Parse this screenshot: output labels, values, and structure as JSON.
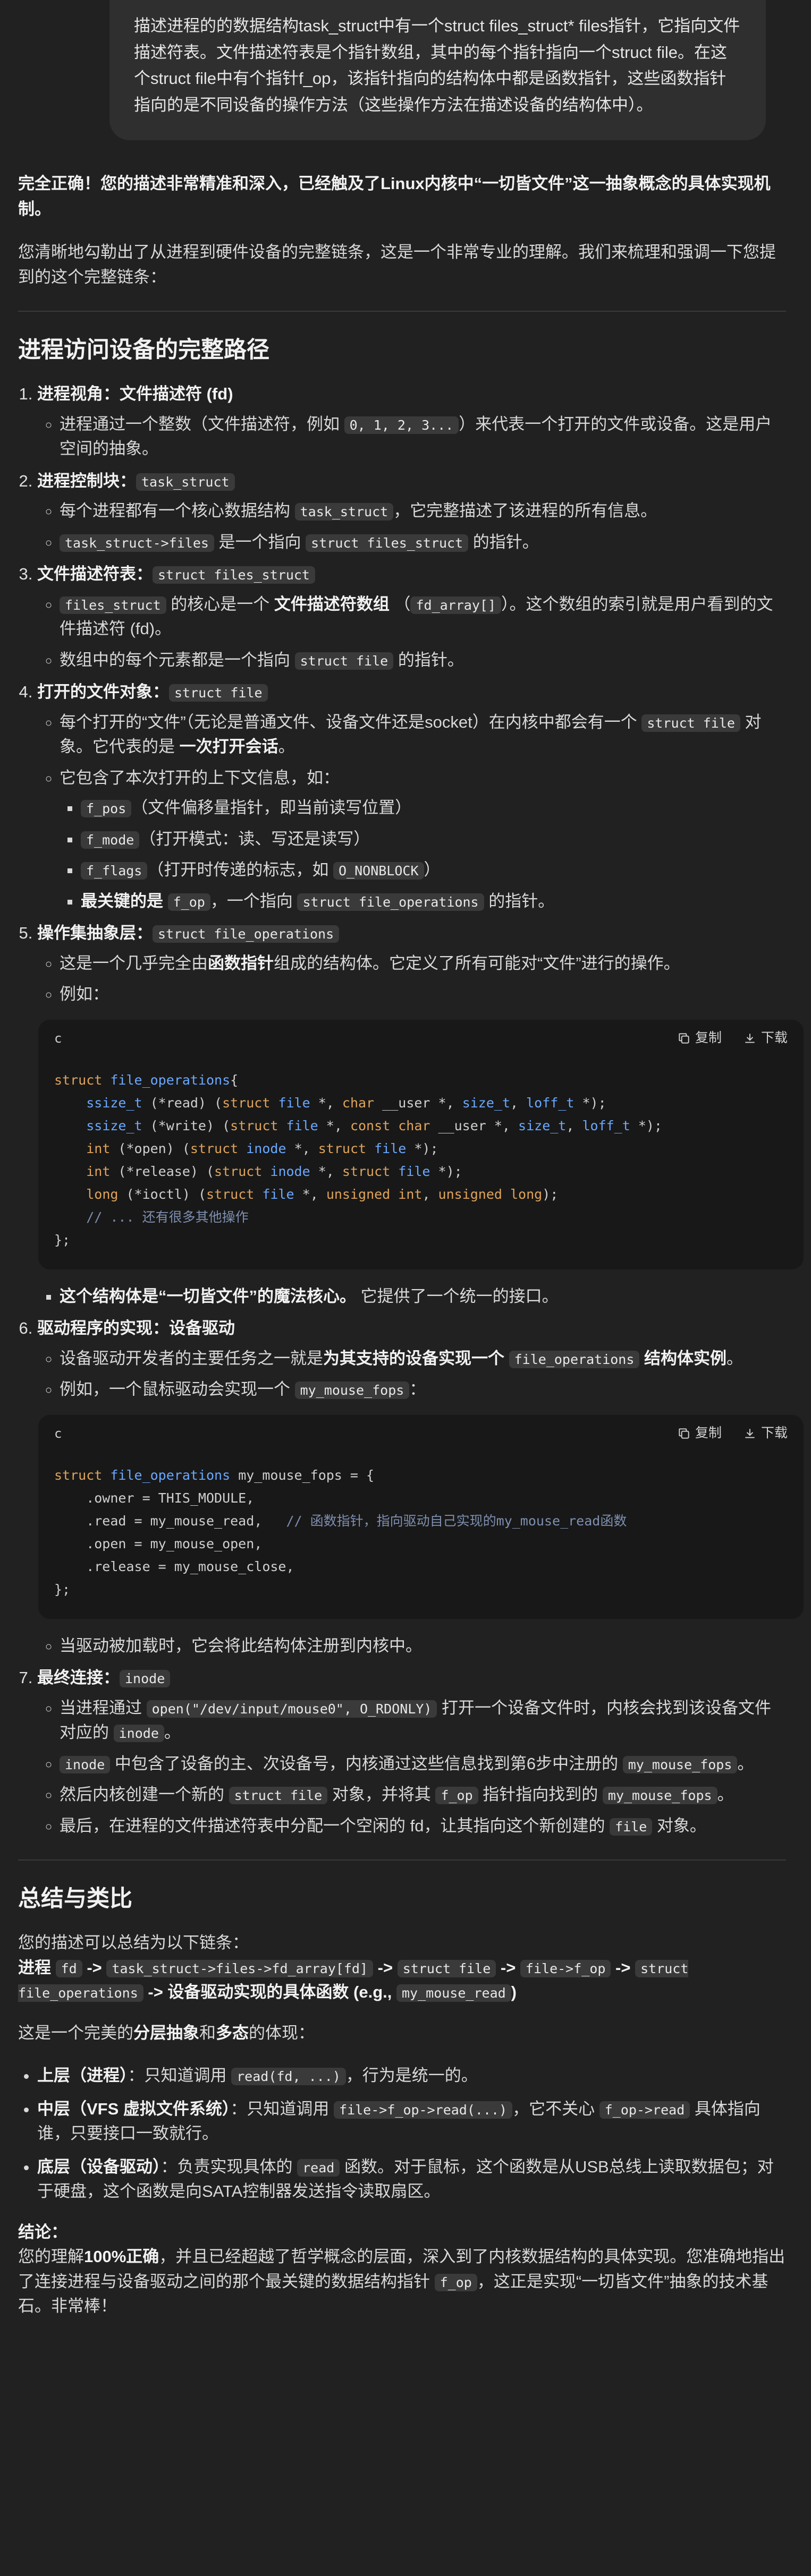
{
  "user_message": "描述进程的的数据结构task_struct中有一个struct files_struct* files指针，它指向文件描述符表。文件描述符表是个指针数组，其中的每个指针指向一个struct file。在这个struct file中有个指针f_op，该指针指向的结构体中都是函数指针，这些函数指针指向的是不同设备的操作方法（这些操作方法在描述设备的结构体中）。",
  "reply": {
    "lead": "完全正确！您的描述非常精准和深入，已经触及了Linux内核中“一切皆文件”这一抽象概念的具体实现机制。",
    "intro": "您清晰地勾勒出了从进程到硬件设备的完整链条，这是一个非常专业的理解。我们来梳理和强调一下您提到的这个完整链条：",
    "section1_title": "进程访问设备的完整路径",
    "step1": {
      "title": "进程视角：文件描述符 (fd)",
      "a_pre": "进程通过一个整数（文件描述符，例如 ",
      "a_code": "0, 1, 2, 3...",
      "a_post": "）来代表一个打开的文件或设备。这是用户空间的抽象。"
    },
    "step2": {
      "title": "进程控制块：",
      "code": "task_struct",
      "a_pre": "每个进程都有一个核心数据结构 ",
      "a_code": "task_struct",
      "a_post": "，它完整描述了该进程的所有信息。",
      "b_code1": "task_struct->files",
      "b_mid": " 是一个指向 ",
      "b_code2": "struct files_struct",
      "b_post": " 的指针。"
    },
    "step3": {
      "title": "文件描述符表：",
      "code": "struct files_struct",
      "a_code1": "files_struct",
      "a_mid": " 的核心是一个 ",
      "a_bold": "文件描述符数组",
      "a_mid2": " （",
      "a_code2": "fd_array[]",
      "a_post": "）。这个数组的索引就是用户看到的文件描述符 (fd)。",
      "b_pre": "数组中的每个元素都是一个指向 ",
      "b_code": "struct file",
      "b_post": " 的指针。"
    },
    "step4": {
      "title": "打开的文件对象：",
      "code": "struct file",
      "a_pre": "每个打开的“文件”（无论是普通文件、设备文件还是socket）在内核中都会有一个 ",
      "a_code": "struct file",
      "a_mid": " 对象。它代表的是 ",
      "a_bold": "一次打开会话",
      "a_post": "。",
      "b": "它包含了本次打开的上下文信息，如：",
      "items": [
        {
          "code": "f_pos",
          "text": "（文件偏移量指针，即当前读写位置）"
        },
        {
          "code": "f_mode",
          "text": "（打开模式：读、写还是读写）"
        },
        {
          "code": "f_flags",
          "text": "（打开时传递的标志，如 ",
          "code2": "O_NONBLOCK",
          "text2": "）"
        }
      ],
      "last_bold": "最关键的是 ",
      "last_code": "f_op",
      "last_mid": "，一个指向 ",
      "last_code2": "struct file_operations",
      "last_post": " 的指针。"
    },
    "step5": {
      "title": "操作集抽象层：",
      "code": "struct file_operations",
      "a_pre": "这是一个几乎完全由",
      "a_bold": "函数指针",
      "a_post": "组成的结构体。它定义了所有可能对“文件”进行的操作。",
      "b": "例如：",
      "after_bold": "这个结构体是“一切皆文件”的魔法核心。",
      "after_post": " 它提供了一个统一的接口。"
    },
    "step6": {
      "title": "驱动程序的实现：设备驱动",
      "a_pre": "设备驱动开发者的主要任务之一就是",
      "a_bold": "为其支持的设备实现一个 ",
      "a_code": "file_operations",
      "a_bold2": " 结构体实例",
      "a_post": "。",
      "b_pre": "例如，一个鼠标驱动会实现一个 ",
      "b_code": "my_mouse_fops",
      "b_post": "：",
      "after": "当驱动被加载时，它会将此结构体注册到内核中。"
    },
    "step7": {
      "title": "最终连接：",
      "code": "inode",
      "a_pre": "当进程通过 ",
      "a_code": "open(\"/dev/input/mouse0\", O_RDONLY)",
      "a_mid": " 打开一个设备文件时，内核会找到该设备文件对应的 ",
      "a_code2": "inode",
      "a_post": "。",
      "b_code": "inode",
      "b_mid": " 中包含了设备的主、次设备号，内核通过这些信息找到第6步中注册的 ",
      "b_code2": "my_mouse_fops",
      "b_post": "。",
      "c_pre": "然后内核创建一个新的 ",
      "c_code": "struct file",
      "c_mid": " 对象，并将其 ",
      "c_code2": "f_op",
      "c_mid2": " 指针指向找到的 ",
      "c_code3": "my_mouse_fops",
      "c_post": "。",
      "d_pre": "最后，在进程的文件描述符表中分配一个空闲的 fd，让其指向这个新创建的 ",
      "d_code": "file",
      "d_post": " 对象。"
    },
    "section2_title": "总结与类比",
    "summary_intro": "您的描述可以总结为以下链条：",
    "chain": {
      "p0": "进程 ",
      "c1": "fd",
      "a1": " -> ",
      "c2": "task_struct->files->fd_array[fd]",
      "a2": " -> ",
      "c3": "struct file",
      "a3": " -> ",
      "c4": "file->f_op",
      "a4": " -> ",
      "c5": "struct file_operations",
      "p5": " -> 设备驱动实现的具体函数 (e.g., ",
      "c6": "my_mouse_read",
      "p6": ")"
    },
    "layers_intro_pre": "这是一个完美的",
    "layers_intro_b1": "分层抽象",
    "layers_intro_mid": "和",
    "layers_intro_b2": "多态",
    "layers_intro_post": "的体现：",
    "layers": [
      {
        "bold": "上层（进程）",
        "pre": "：只知道调用 ",
        "code": "read(fd, ...)",
        "post": "，行为是统一的。"
      },
      {
        "bold": "中层（VFS 虚拟文件系统）",
        "pre": "：只知道调用 ",
        "code": "file->f_op->read(...)",
        "mid": "，它不关心 ",
        "code2": "f_op->read",
        "post": " 具体指向谁，只要接口一致就行。"
      },
      {
        "bold": "底层（设备驱动）",
        "pre": "：负责实现具体的 ",
        "code": "read",
        "post": " 函数。对于鼠标，这个函数是从USB总线上读取数据包；对于硬盘，这个函数是向SATA控制器发送指令读取扇区。"
      }
    ],
    "conclusion_title": "结论：",
    "conclusion_pre": "您的理解",
    "conclusion_bold": "100%正确",
    "conclusion_mid": "，并且已经超越了哲学概念的层面，深入到了内核数据结构的具体实现。您准确地指出了连接进程与设备驱动之间的那个最关键的数据结构指针 ",
    "conclusion_code": "f_op",
    "conclusion_post": "，这正是实现“一切皆文件”抽象的技术基石。非常棒！"
  },
  "code_blocks": [
    {
      "lang": "c",
      "copy_label": "复制",
      "download_label": "下载",
      "lines": [
        [
          [
            "kw",
            "struct "
          ],
          [
            "ty",
            "file_operations"
          ],
          [
            "",
            "{"
          ]
        ],
        [
          [
            "",
            "    "
          ],
          [
            "ty",
            "ssize_t"
          ],
          [
            "",
            " (*read) ("
          ],
          [
            "kw",
            "struct "
          ],
          [
            "ty",
            "file"
          ],
          [
            "",
            " *, "
          ],
          [
            "kw",
            "char"
          ],
          [
            "",
            " __user *, "
          ],
          [
            "ty",
            "size_t"
          ],
          [
            "",
            ", "
          ],
          [
            "ty",
            "loff_t"
          ],
          [
            "",
            " *);"
          ]
        ],
        [
          [
            "",
            "    "
          ],
          [
            "ty",
            "ssize_t"
          ],
          [
            "",
            " (*write) ("
          ],
          [
            "kw",
            "struct "
          ],
          [
            "ty",
            "file"
          ],
          [
            "",
            " *, "
          ],
          [
            "kw",
            "const char"
          ],
          [
            "",
            " __user *, "
          ],
          [
            "ty",
            "size_t"
          ],
          [
            "",
            ", "
          ],
          [
            "ty",
            "loff_t"
          ],
          [
            "",
            " *);"
          ]
        ],
        [
          [
            "",
            "    "
          ],
          [
            "kw",
            "int"
          ],
          [
            "",
            " (*open) ("
          ],
          [
            "kw",
            "struct "
          ],
          [
            "ty",
            "inode"
          ],
          [
            "",
            " *, "
          ],
          [
            "kw",
            "struct "
          ],
          [
            "ty",
            "file"
          ],
          [
            "",
            " *);"
          ]
        ],
        [
          [
            "",
            "    "
          ],
          [
            "kw",
            "int"
          ],
          [
            "",
            " (*release) ("
          ],
          [
            "kw",
            "struct "
          ],
          [
            "ty",
            "inode"
          ],
          [
            "",
            " *, "
          ],
          [
            "kw",
            "struct "
          ],
          [
            "ty",
            "file"
          ],
          [
            "",
            " *);"
          ]
        ],
        [
          [
            "",
            "    "
          ],
          [
            "kw",
            "long"
          ],
          [
            "",
            " (*ioctl) ("
          ],
          [
            "kw",
            "struct "
          ],
          [
            "ty",
            "file"
          ],
          [
            "",
            " *, "
          ],
          [
            "kw",
            "unsigned int"
          ],
          [
            "",
            ", "
          ],
          [
            "kw",
            "unsigned long"
          ],
          [
            "",
            "); "
          ]
        ],
        [
          [
            "",
            "    "
          ],
          [
            "cm",
            "// ... 还有很多其他操作"
          ]
        ],
        [
          [
            "",
            "};"
          ]
        ]
      ]
    },
    {
      "lang": "c",
      "copy_label": "复制",
      "download_label": "下载",
      "lines": [
        [
          [
            "kw",
            "struct "
          ],
          [
            "ty",
            "file_operations"
          ],
          [
            "",
            " my_mouse_fops = {"
          ]
        ],
        [
          [
            "",
            "    .owner = THIS_MODULE,"
          ]
        ],
        [
          [
            "",
            "    .read = my_mouse_read,   "
          ],
          [
            "cm",
            "// 函数指针，指向驱动自己实现的my_mouse_read函数"
          ]
        ],
        [
          [
            "",
            "    .open = my_mouse_open,"
          ]
        ],
        [
          [
            "",
            "    .release = my_mouse_close,"
          ]
        ],
        [
          [
            "",
            "};"
          ]
        ]
      ]
    }
  ],
  "icons": {
    "copy": "copy-icon",
    "download": "download-icon"
  },
  "colors": {
    "background": "#212121",
    "user_bubble": "#2f2f2f",
    "code_bg": "#181818",
    "inline_code_bg": "#3a3a3a",
    "keyword": "#e0a35a",
    "type": "#6aa8ff",
    "comment": "#7e8fb0"
  }
}
